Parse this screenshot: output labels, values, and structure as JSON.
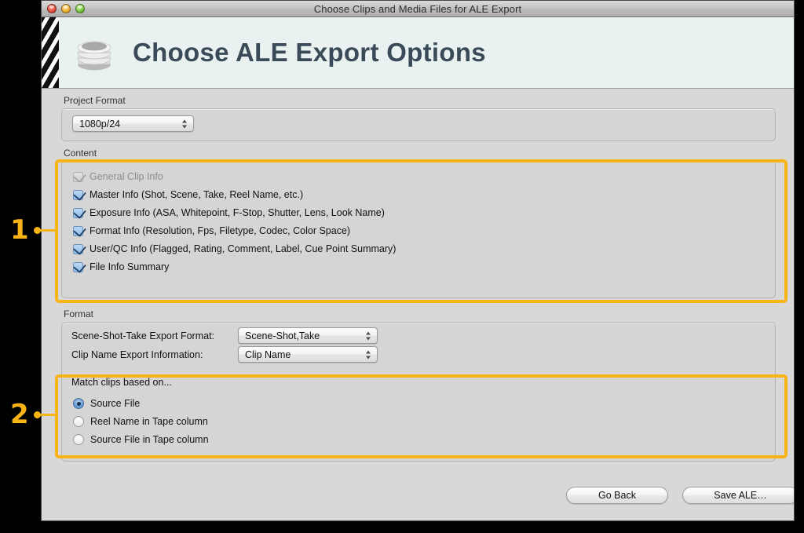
{
  "window": {
    "title": "Choose Clips and Media Files for ALE Export",
    "traffic_lights": [
      "close",
      "minimize",
      "zoom"
    ]
  },
  "banner": {
    "icon": "disk-stack-icon",
    "heading": "Choose ALE Export Options"
  },
  "project_format": {
    "caption": "Project Format",
    "popup_value": "1080p/24"
  },
  "content": {
    "caption": "Content",
    "items": [
      {
        "label": "General Clip Info",
        "checked": true,
        "disabled": true
      },
      {
        "label": "Master Info (Shot, Scene, Take, Reel Name, etc.)",
        "checked": true,
        "disabled": false
      },
      {
        "label": "Exposure Info (ASA, Whitepoint, F-Stop, Shutter, Lens, Look Name)",
        "checked": true,
        "disabled": false
      },
      {
        "label": "Format Info (Resolution, Fps, Filetype, Codec, Color Space)",
        "checked": true,
        "disabled": false
      },
      {
        "label": "User/QC Info (Flagged, Rating, Comment, Label, Cue Point Summary)",
        "checked": true,
        "disabled": false
      },
      {
        "label": "File Info Summary",
        "checked": true,
        "disabled": false
      }
    ]
  },
  "format": {
    "caption": "Format",
    "rows": [
      {
        "label": "Scene-Shot-Take Export Format:",
        "value": "Scene-Shot,Take"
      },
      {
        "label": "Clip Name Export Information:",
        "value": "Clip Name"
      }
    ],
    "match_heading": "Match clips based on...",
    "match_options": [
      {
        "label": "Source File",
        "selected": true
      },
      {
        "label": "Reel Name in Tape column",
        "selected": false
      },
      {
        "label": "Source File in Tape column",
        "selected": false
      }
    ]
  },
  "footer": {
    "go_back": "Go Back",
    "save_ale": "Save ALE…"
  },
  "annotations": [
    {
      "number": "1",
      "target": "content-group"
    },
    {
      "number": "2",
      "target": "match-clips-group"
    }
  ],
  "colors": {
    "highlight": "#f8b417",
    "banner_bg": "#e9f2f0",
    "banner_text": "#3b4a59",
    "checkbox_blue": "#8fbbe8"
  }
}
